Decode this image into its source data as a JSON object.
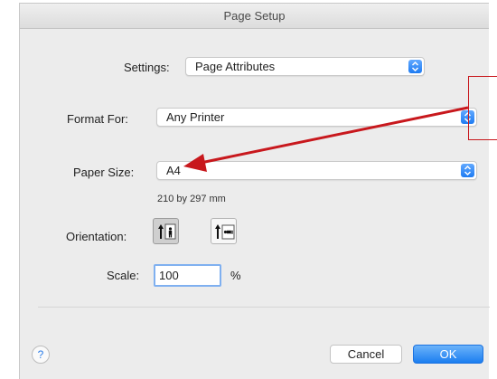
{
  "window": {
    "title": "Page Setup"
  },
  "settings": {
    "label": "Settings:",
    "value": "Page Attributes"
  },
  "format_for": {
    "label": "Format For:",
    "value": "Any Printer"
  },
  "paper_size": {
    "label": "Paper Size:",
    "value": "A4",
    "dimensions": "210 by 297 mm"
  },
  "orientation": {
    "label": "Orientation:",
    "options": [
      {
        "name": "portrait",
        "icon": "portrait-orientation-icon",
        "selected": true
      },
      {
        "name": "landscape",
        "icon": "landscape-orientation-icon",
        "selected": false
      }
    ]
  },
  "scale": {
    "label": "Scale:",
    "value": "100",
    "unit": "%"
  },
  "buttons": {
    "help": "?",
    "cancel": "Cancel",
    "ok": "OK"
  },
  "colors": {
    "accent": "#1e7bf2",
    "annotation": "#c8181d"
  }
}
